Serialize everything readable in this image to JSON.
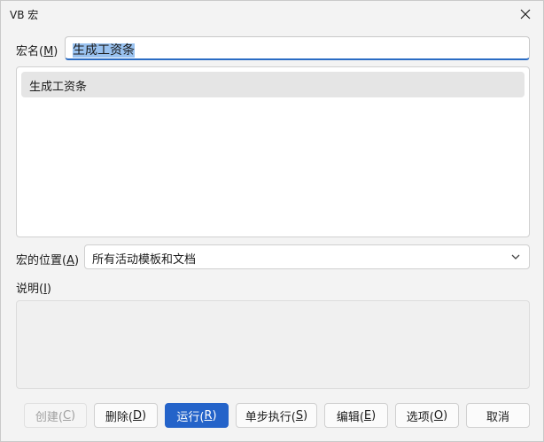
{
  "window": {
    "title": "VB 宏",
    "close_icon": "close-icon"
  },
  "form": {
    "name_label": "宏名(",
    "name_label_key": "M",
    "name_label_close": ")",
    "name_value": "生成工资条",
    "macro_list": [
      "生成工资条"
    ],
    "location_label": "宏的位置(",
    "location_label_key": "A",
    "location_label_close": ")",
    "location_value": "所有活动模板和文档",
    "description_label": "说明(",
    "description_label_key": "I",
    "description_label_close": ")"
  },
  "buttons": {
    "create": {
      "text": "创建(",
      "key": "C",
      "close": ")"
    },
    "delete": {
      "text": "删除(",
      "key": "D",
      "close": ")"
    },
    "run": {
      "text": "运行(",
      "key": "R",
      "close": ")"
    },
    "step": {
      "text": "单步执行(",
      "key": "S",
      "close": ")"
    },
    "edit": {
      "text": "编辑(",
      "key": "E",
      "close": ")"
    },
    "options": {
      "text": "选项(",
      "key": "O",
      "close": ")"
    },
    "cancel": {
      "text": "取消"
    }
  },
  "colors": {
    "accent": "#2463c9",
    "selection": "#99c2f0"
  }
}
